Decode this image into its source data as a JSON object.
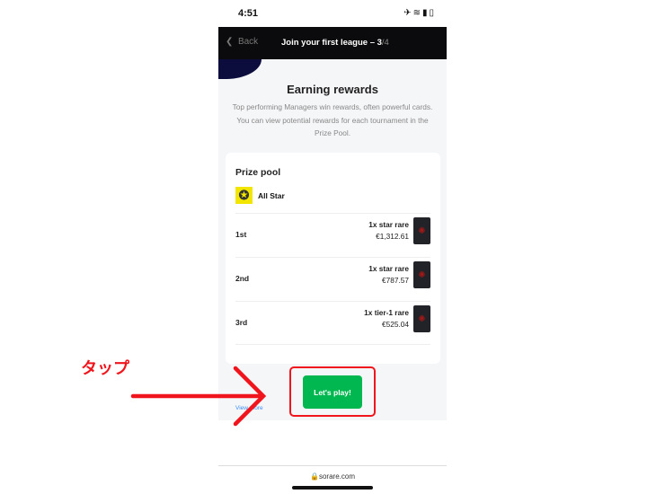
{
  "status_bar": {
    "time": "4:51",
    "icons": [
      "airplane-icon",
      "wifi-icon",
      "battery-icon"
    ]
  },
  "nav": {
    "back_label": "Back",
    "title": "Join your first league – 3",
    "step_total": "/4"
  },
  "main": {
    "title": "Earning rewards",
    "description": "Top performing Managers win rewards, often powerful cards. You can view potential rewards for each tournament in the Prize Pool."
  },
  "prize_pool": {
    "title": "Prize pool",
    "league": "All Star",
    "rows": [
      {
        "rank": "1st",
        "reward": "1x star rare",
        "value": "€1,312.61"
      },
      {
        "rank": "2nd",
        "reward": "1x star rare",
        "value": "€787.57"
      },
      {
        "rank": "3rd",
        "reward": "1x tier-1 rare",
        "value": "€525.04"
      }
    ],
    "view_more": "View more"
  },
  "cta": {
    "label": "Let's play!",
    "color": "#00b84f"
  },
  "browser": {
    "url": "sorare.com"
  },
  "annotation": {
    "label": "タップ",
    "color": "#f0151c"
  }
}
